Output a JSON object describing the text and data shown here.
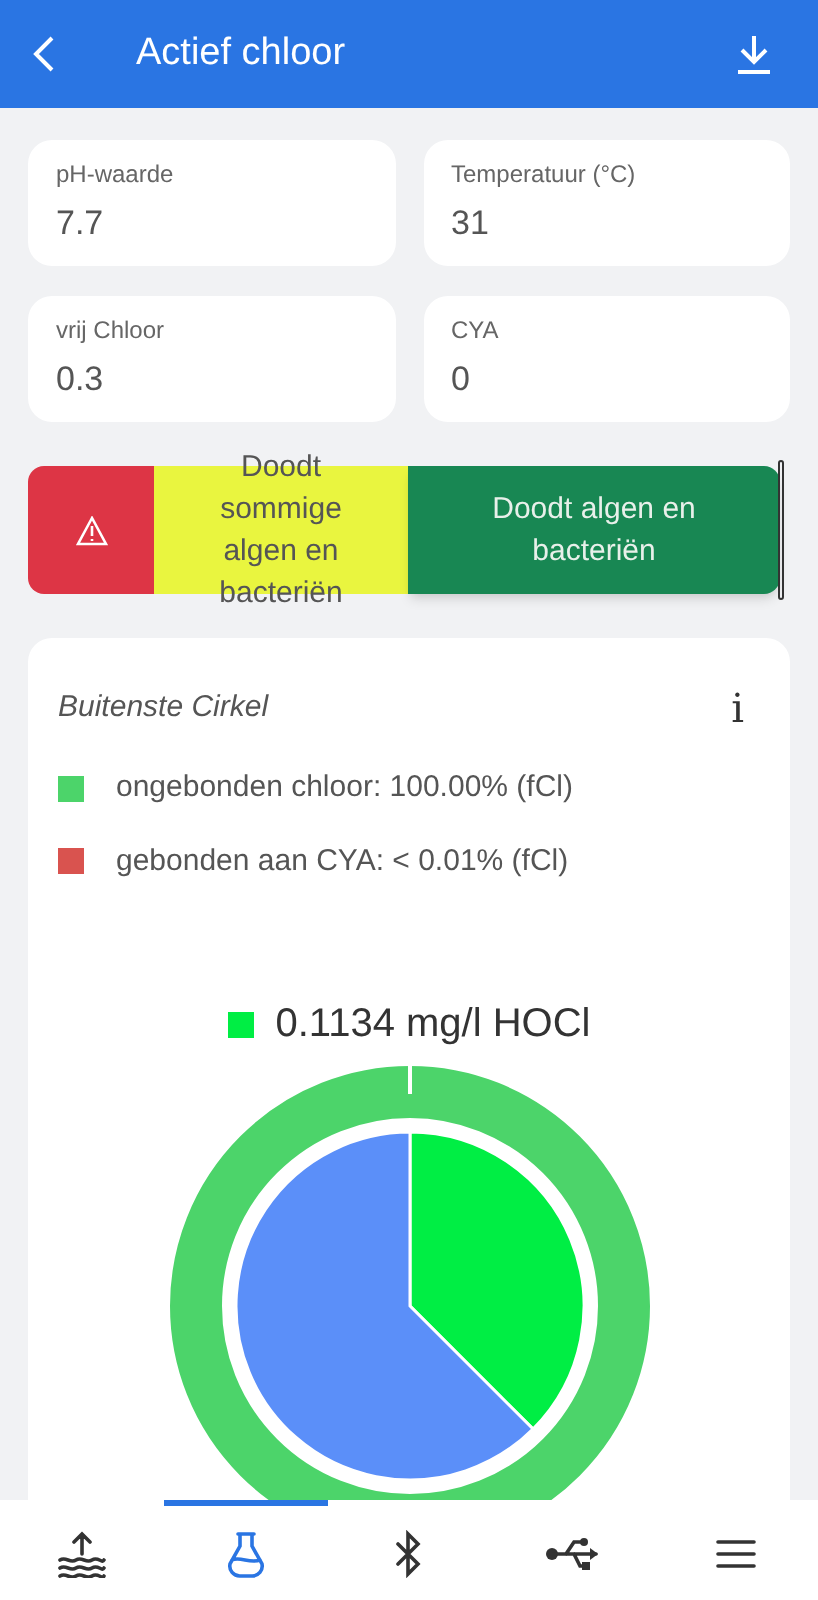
{
  "header": {
    "title": "Actief chloor"
  },
  "measurements": [
    {
      "label": "pH-waarde",
      "value": "7.7"
    },
    {
      "label": "Temperatuur (°C)",
      "value": "31"
    },
    {
      "label": "vrij Chloor",
      "value": "0.3"
    },
    {
      "label": "CYA",
      "value": "0"
    }
  ],
  "effect_bar": [
    {
      "kind": "warning",
      "color": "#dd3545"
    },
    {
      "kind": "text",
      "color": "#e9f53f",
      "text": "Doodt sommige algen en bacteriën"
    },
    {
      "kind": "text",
      "color": "#188753",
      "text": "Doodt algen en bacteriën"
    }
  ],
  "chart_card": {
    "title": "Buitenste Cirkel",
    "info": "i",
    "legend": [
      {
        "label": "ongebonden chloor: 100.00% (fCl)",
        "color": "#4cd46a"
      },
      {
        "label": "gebonden aan CYA: < 0.01% (fCl)",
        "color": "#d9534f"
      }
    ],
    "result": {
      "label": "0.1134 mg/l HOCl",
      "color": "#00ee44"
    }
  },
  "nav": [
    {
      "kind": "pool",
      "selected": false
    },
    {
      "kind": "flask",
      "selected": true
    },
    {
      "kind": "bluetooth",
      "selected": false
    },
    {
      "kind": "usb",
      "selected": false
    },
    {
      "kind": "menu",
      "selected": false
    }
  ]
}
